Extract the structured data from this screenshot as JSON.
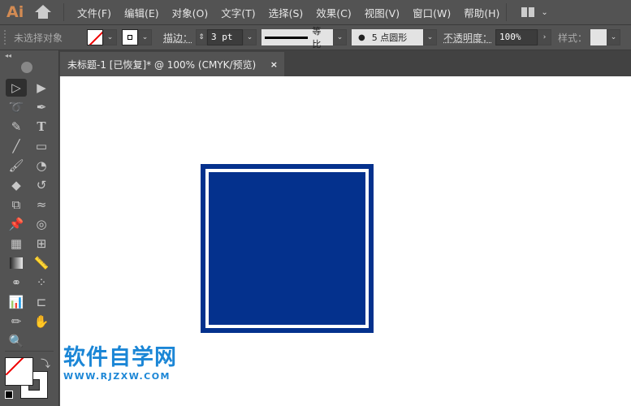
{
  "app": {
    "logo": "Ai"
  },
  "menu": [
    "文件(F)",
    "编辑(E)",
    "对象(O)",
    "文字(T)",
    "选择(S)",
    "效果(C)",
    "视图(V)",
    "窗口(W)",
    "帮助(H)"
  ],
  "control": {
    "selection": "未选择对象",
    "stroke_label": "描边：",
    "stroke_value": "3 pt",
    "stroke_profile": "等比",
    "brush": "5 点圆形",
    "opacity_label": "不透明度：",
    "opacity_value": "100%",
    "style_label": "样式："
  },
  "tab": {
    "title": "未标题-1 [已恢复]* @ 100% (CMYK/预览)",
    "close": "×"
  },
  "artwork": {
    "fill": "#04318d",
    "stroke": "#ffffff"
  },
  "watermark": {
    "title": "软件自学网",
    "url": "WWW.RJZXW.COM"
  },
  "tools": [
    "selection",
    "direct-selection",
    "lasso",
    "pen",
    "curvature",
    "type",
    "line",
    "rectangle",
    "paintbrush",
    "shaper",
    "eraser",
    "rotate",
    "scale",
    "warp",
    "puppet-warp",
    "free-transform",
    "perspective-grid",
    "mesh",
    "gradient",
    "measure",
    "shape-builder",
    "symbol-sprayer",
    "column-graph",
    "artboard",
    "pencil",
    "hand",
    "zoom"
  ]
}
